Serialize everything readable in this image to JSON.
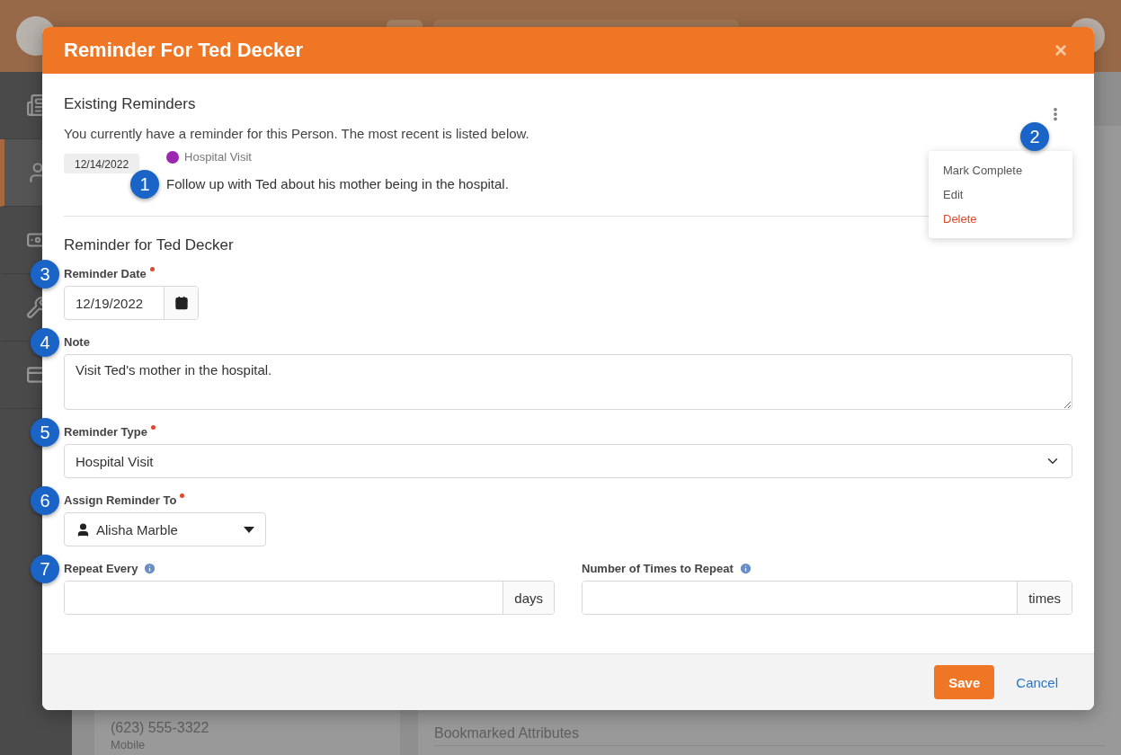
{
  "sidebar": {
    "items": [
      {
        "selected": false
      },
      {
        "selected": true
      },
      {
        "selected": false
      },
      {
        "selected": false
      },
      {
        "selected": false
      }
    ]
  },
  "background": {
    "phone": "(623) 555-3322",
    "phone_type": "Mobile",
    "panel_title": "Bookmarked Attributes"
  },
  "modal": {
    "title": "Reminder For Ted Decker",
    "close": "×",
    "existing": {
      "heading": "Existing Reminders",
      "intro": "You currently have a reminder for this Person. The most recent is listed below.",
      "reminder": {
        "date": "12/14/2022",
        "type": "Hospital Visit",
        "color": "#9c27b0",
        "note": "Follow up with Ted about his mother being in the hospital.",
        "callout": "1"
      },
      "menu": {
        "callout": "2",
        "items": [
          {
            "label": "Mark Complete",
            "kind": "normal"
          },
          {
            "label": "Edit",
            "kind": "normal"
          },
          {
            "label": "Delete",
            "kind": "danger"
          }
        ]
      }
    },
    "form": {
      "heading": "Reminder for Ted Decker",
      "fields": [
        {
          "kind": "date",
          "callout": "3",
          "label": "Reminder Date",
          "required": true,
          "value": "12/19/2022"
        },
        {
          "kind": "textarea",
          "callout": "4",
          "label": "Note",
          "value": "Visit Ted's mother in the hospital."
        },
        {
          "kind": "select",
          "callout": "5",
          "label": "Reminder Type",
          "required": true,
          "value": "Hospital Visit"
        },
        {
          "kind": "person",
          "callout": "6",
          "label": "Assign Reminder To",
          "required": true,
          "value": "Alisha Marble"
        },
        {
          "kind": "pair",
          "callout": "7",
          "items": [
            {
              "label": "Repeat Every",
              "info": true,
              "addon": "days"
            },
            {
              "label": "Number of Times to Repeat",
              "info": true,
              "addon": "times"
            }
          ]
        }
      ]
    },
    "footer": {
      "save": "Save",
      "cancel": "Cancel"
    }
  }
}
